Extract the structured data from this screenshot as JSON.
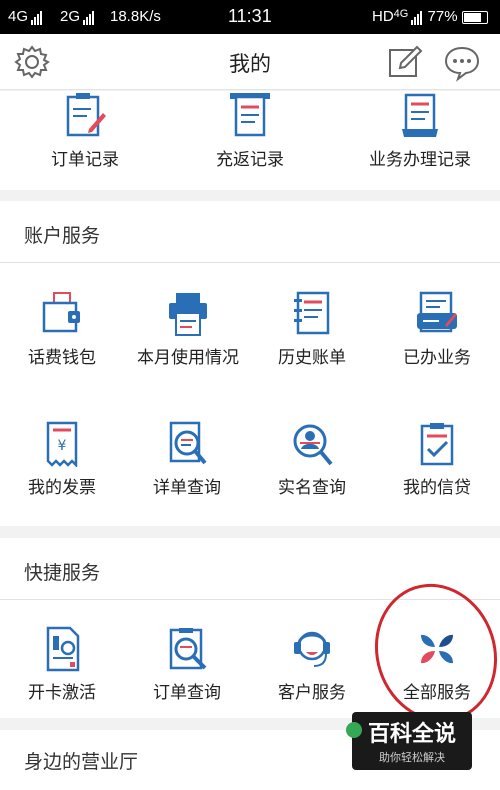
{
  "status_bar": {
    "net1": "4G",
    "net2": "2G",
    "speed": "18.8K/s",
    "time": "11:31",
    "hd": "HD",
    "net3": "4G",
    "battery": "77%"
  },
  "nav": {
    "title": "我的"
  },
  "records": {
    "items": [
      {
        "label": "订单记录",
        "icon": "order-record-icon"
      },
      {
        "label": "充返记录",
        "icon": "recharge-record-icon"
      },
      {
        "label": "业务办理记录",
        "icon": "business-record-icon"
      }
    ]
  },
  "account": {
    "title": "账户服务",
    "items": [
      {
        "label": "话费钱包",
        "icon": "wallet-icon"
      },
      {
        "label": "本月使用情况",
        "icon": "printer-icon"
      },
      {
        "label": "历史账单",
        "icon": "notebook-icon"
      },
      {
        "label": "已办业务",
        "icon": "id-card-icon"
      },
      {
        "label": "我的发票",
        "icon": "invoice-icon"
      },
      {
        "label": "详单查询",
        "icon": "detail-search-icon"
      },
      {
        "label": "实名查询",
        "icon": "realname-search-icon"
      },
      {
        "label": "我的信贷",
        "icon": "clipboard-check-icon"
      }
    ]
  },
  "quick": {
    "title": "快捷服务",
    "items": [
      {
        "label": "开卡激活",
        "icon": "sim-card-icon"
      },
      {
        "label": "订单查询",
        "icon": "order-search-icon"
      },
      {
        "label": "客户服务",
        "icon": "headset-icon"
      },
      {
        "label": "全部服务",
        "icon": "petals-icon"
      }
    ]
  },
  "nearby": {
    "title": "身边的营业厅"
  },
  "watermark": {
    "main": "百科全说",
    "sub": "助你轻松解决"
  },
  "colors": {
    "blue": "#2a6fb5",
    "red": "#e24b5b",
    "annotation_red": "#d0262e"
  }
}
